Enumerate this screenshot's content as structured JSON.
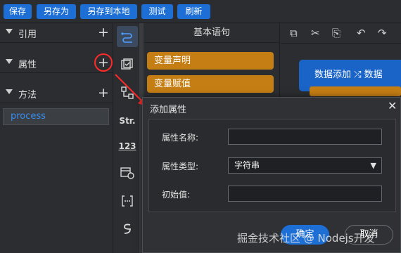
{
  "toolbar": {
    "save": "保存",
    "save_as": "另存为",
    "save_local": "另存到本地",
    "test": "测试",
    "refresh": "刷新"
  },
  "left_panel": {
    "sections": [
      {
        "label": "引用"
      },
      {
        "label": "属性"
      },
      {
        "label": "方法"
      }
    ],
    "methods": [
      {
        "label": "process"
      }
    ]
  },
  "icons": [
    "connection-icon",
    "checkbox-icon",
    "tree-icon",
    "string-icon",
    "number-icon",
    "datetime-icon",
    "array-icon",
    "script-icon"
  ],
  "icon_text": {
    "str": "Str.",
    "num": "123"
  },
  "statements": {
    "title": "基本语句",
    "items": [
      "变量声明",
      "变量赋值"
    ]
  },
  "canvas": {
    "node_label": "数据添加 ⤮  数据"
  },
  "dialog": {
    "title": "添加属性",
    "fields": {
      "name_label": "属性名称:",
      "name_value": "",
      "type_label": "属性类型:",
      "type_value": "字符串",
      "default_label": "初始值:",
      "default_value": ""
    },
    "ok": "确定",
    "cancel": "取消"
  },
  "watermark": "掘金技术社区 @ Nodejs开发",
  "colors": {
    "primary": "#1d6fd6",
    "statement": "#c57e14",
    "highlight": "#ff2a2a",
    "background": "#2b2d30"
  }
}
